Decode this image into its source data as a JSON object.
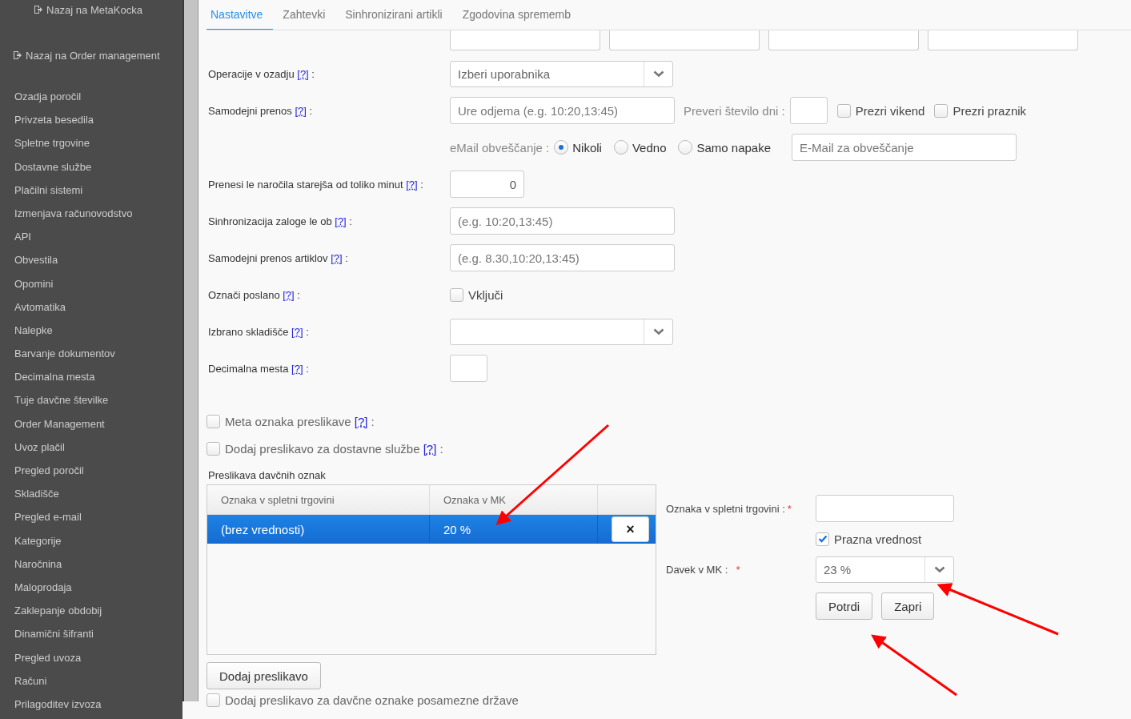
{
  "sidebar": {
    "back_links": [
      "Nazaj na MetaKocka",
      "Nazaj na Order management"
    ],
    "items": [
      "Ozadja poročil",
      "Privzeta besedila",
      "Spletne trgovine",
      "Dostavne službe",
      "Plačilni sistemi",
      "Izmenjava računovodstvo",
      "API",
      "Obvestila",
      "Opomini",
      "Avtomatika",
      "Nalepke",
      "Barvanje dokumentov",
      "Decimalna mesta",
      "Tuje davčne številke",
      "Order Management",
      "Uvoz plačil",
      "Pregled poročil",
      "Skladišče",
      "Pregled e-mail",
      "Kategorije",
      "Naročnina",
      "Maloprodaja",
      "Zaklepanje obdobij",
      "Dinamični šifranti",
      "Pregled uvoza",
      "Računi",
      "Prilagoditev izvoza"
    ]
  },
  "tabs": [
    {
      "label": "Nastavitve",
      "selected": true
    },
    {
      "label": "Zahtevki",
      "selected": false
    },
    {
      "label": "Sinhronizirani artikli",
      "selected": false
    },
    {
      "label": "Zgodovina sprememb",
      "selected": false
    }
  ],
  "rows": [
    {
      "kind": "select",
      "label": "Operacije v ozadju",
      "help": "[?]",
      "colon": ":",
      "placeholder": "Izberi uporabnika"
    },
    {
      "kind": "auto",
      "label": "Samodejni prenos",
      "help": "[?]",
      "colon": ":",
      "placeholder": "Ure odjema (e.g. 10:20,13:45)",
      "days_label": "Preveri število dni :",
      "checks": [
        {
          "label": "Prezri vikend",
          "checked": false
        },
        {
          "label": "Prezri praznik",
          "checked": false
        }
      ]
    },
    {
      "kind": "email",
      "inline_label": "eMail obveščanje :",
      "options": [
        {
          "label": "Nikoli",
          "selected": true
        },
        {
          "label": "Vedno",
          "selected": false
        },
        {
          "label": "Samo napake",
          "selected": false
        }
      ],
      "placeholder": "E-Mail za obveščanje"
    },
    {
      "kind": "number",
      "label": "Prenesi le naročila starejša od toliko minut",
      "help": "[?]",
      "colon": ":",
      "value": "0"
    },
    {
      "kind": "text",
      "label": "Sinhronizacija zaloge le ob",
      "help": "[?]",
      "colon": ":",
      "placeholder": "(e.g. 10:20,13:45)"
    },
    {
      "kind": "text",
      "label": "Samodejni prenos artiklov",
      "help": "[?]",
      "colon": ":",
      "placeholder": "(e.g. 8.30,10:20,13:45)"
    },
    {
      "kind": "check",
      "label": "Označi poslano",
      "help": "[?]",
      "colon": ":",
      "check": {
        "label": "Vključi",
        "checked": false
      }
    },
    {
      "kind": "select",
      "label": "Izbrano skladišče",
      "help": "[?]",
      "colon": ":"
    },
    {
      "kind": "small",
      "label": "Decimalna mesta",
      "help": "[?]",
      "colon": ":"
    }
  ],
  "options": [
    {
      "label": "Meta oznaka preslikave",
      "help": "[?]",
      "colon": ":",
      "checked": false
    },
    {
      "label": "Dodaj preslikavo za dostavne službe",
      "help": "[?]",
      "colon": ":",
      "checked": false
    }
  ],
  "mapping": {
    "title": "Preslikava davčnih oznak",
    "columns": [
      "Oznaka v spletni trgovini",
      "Oznaka v MK"
    ],
    "rows": [
      {
        "cells": [
          "(brez vrednosti)",
          "20 %"
        ],
        "selected": true,
        "delete": "×"
      }
    ],
    "add_button": "Dodaj preslikavo"
  },
  "editor": {
    "shop_label": "Oznaka v spletni trgovini :",
    "tax_label": "Davek v MK :",
    "required": "*",
    "empty_check": {
      "label": "Prazna vrednost",
      "checked": true
    },
    "tax_value": "23 %",
    "buttons": [
      "Potrdi",
      "Zapri"
    ]
  },
  "last_option": {
    "label": "Dodaj preslikavo za davčne oznake posamezne države",
    "checked": false
  }
}
